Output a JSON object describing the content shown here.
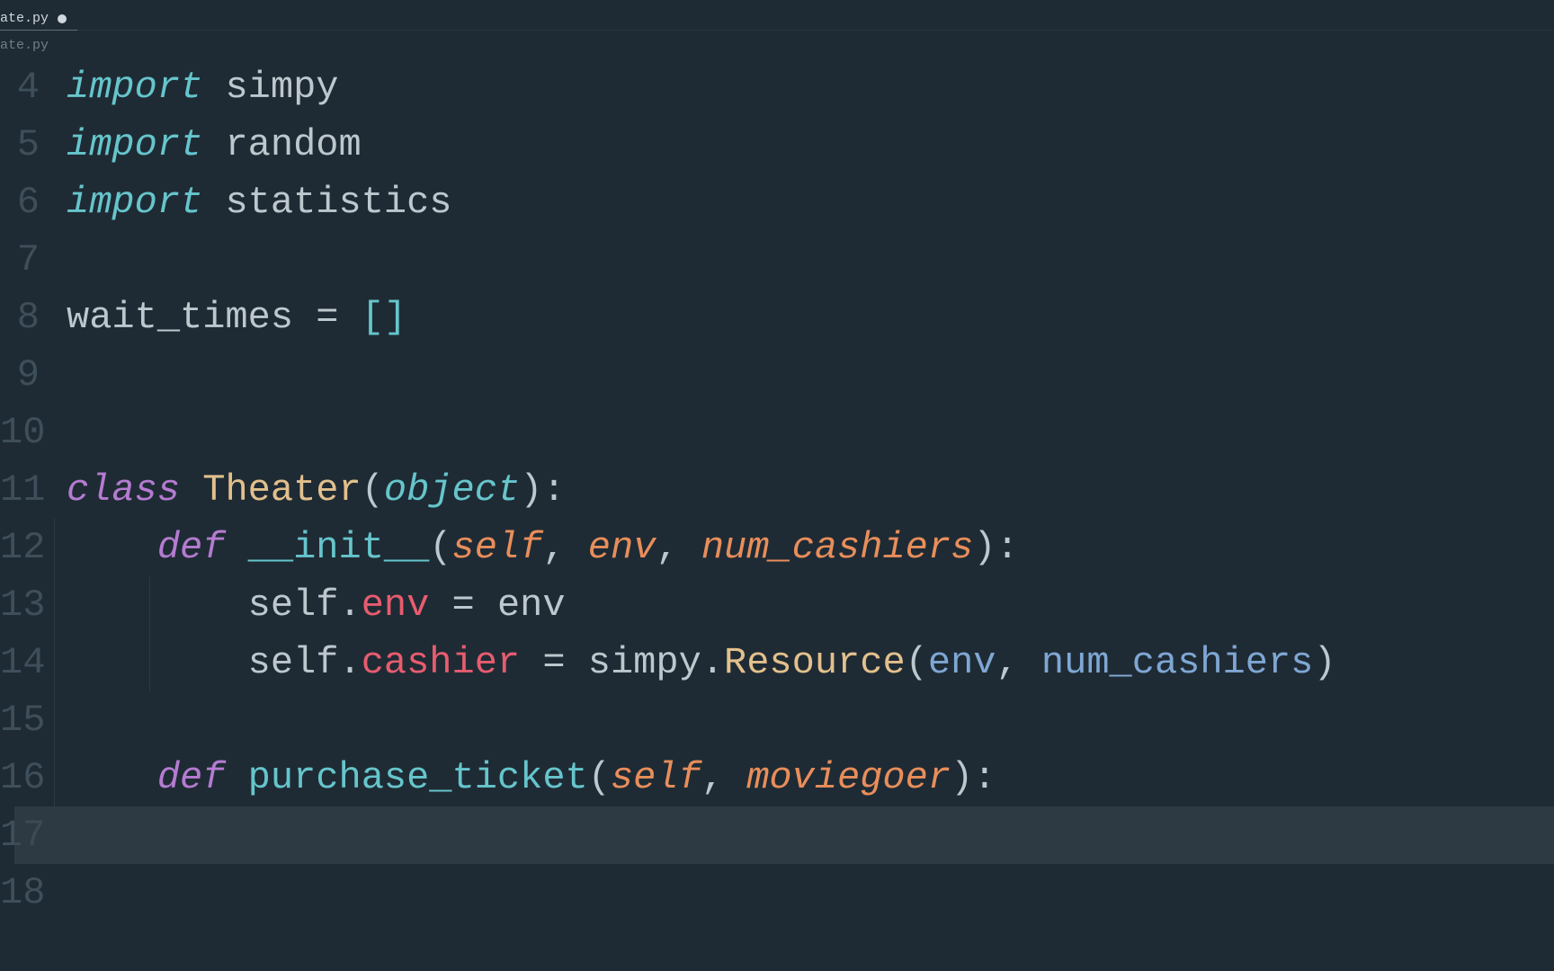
{
  "tab": {
    "filename": "ate.py",
    "modified": true
  },
  "breadcrumb": {
    "filename": "ate.py"
  },
  "code": {
    "first_line_number": 4,
    "lines": [
      {
        "n": 4,
        "tokens": [
          {
            "t": "import",
            "c": "tok-import"
          },
          {
            "t": " ",
            "c": "tok-plain"
          },
          {
            "t": "simpy",
            "c": "tok-plain"
          }
        ]
      },
      {
        "n": 5,
        "tokens": [
          {
            "t": "import",
            "c": "tok-import"
          },
          {
            "t": " ",
            "c": "tok-plain"
          },
          {
            "t": "random",
            "c": "tok-plain"
          }
        ]
      },
      {
        "n": 6,
        "tokens": [
          {
            "t": "import",
            "c": "tok-import"
          },
          {
            "t": " ",
            "c": "tok-plain"
          },
          {
            "t": "statistics",
            "c": "tok-plain"
          }
        ]
      },
      {
        "n": 7,
        "tokens": []
      },
      {
        "n": 8,
        "tokens": [
          {
            "t": "wait_times ",
            "c": "tok-plain"
          },
          {
            "t": "=",
            "c": "tok-op"
          },
          {
            "t": " ",
            "c": "tok-plain"
          },
          {
            "t": "[]",
            "c": "tok-bracket"
          }
        ]
      },
      {
        "n": 9,
        "tokens": []
      },
      {
        "n": 10,
        "tokens": []
      },
      {
        "n": 11,
        "tokens": [
          {
            "t": "class",
            "c": "tok-keyword-class"
          },
          {
            "t": " ",
            "c": "tok-plain"
          },
          {
            "t": "Theater",
            "c": "tok-classname"
          },
          {
            "t": "(",
            "c": "tok-punct"
          },
          {
            "t": "object",
            "c": "tok-builtin"
          },
          {
            "t": ")",
            "c": "tok-punct"
          },
          {
            "t": ":",
            "c": "tok-punct"
          }
        ]
      },
      {
        "n": 12,
        "indent": 1,
        "tokens": [
          {
            "t": "    ",
            "c": "tok-plain"
          },
          {
            "t": "def",
            "c": "tok-keyword-def"
          },
          {
            "t": " ",
            "c": "tok-plain"
          },
          {
            "t": "__init__",
            "c": "tok-magic"
          },
          {
            "t": "(",
            "c": "tok-punct"
          },
          {
            "t": "self",
            "c": "tok-param"
          },
          {
            "t": ", ",
            "c": "tok-punct"
          },
          {
            "t": "env",
            "c": "tok-param"
          },
          {
            "t": ", ",
            "c": "tok-punct"
          },
          {
            "t": "num_cashiers",
            "c": "tok-param"
          },
          {
            "t": ")",
            "c": "tok-punct"
          },
          {
            "t": ":",
            "c": "tok-punct"
          }
        ]
      },
      {
        "n": 13,
        "indent": 2,
        "tokens": [
          {
            "t": "        ",
            "c": "tok-plain"
          },
          {
            "t": "self",
            "c": "tok-self"
          },
          {
            "t": ".",
            "c": "tok-punct"
          },
          {
            "t": "env",
            "c": "tok-attr"
          },
          {
            "t": " ",
            "c": "tok-plain"
          },
          {
            "t": "=",
            "c": "tok-op"
          },
          {
            "t": " env",
            "c": "tok-plain"
          }
        ]
      },
      {
        "n": 14,
        "indent": 2,
        "tokens": [
          {
            "t": "        ",
            "c": "tok-plain"
          },
          {
            "t": "self",
            "c": "tok-self"
          },
          {
            "t": ".",
            "c": "tok-punct"
          },
          {
            "t": "cashier",
            "c": "tok-attr"
          },
          {
            "t": " ",
            "c": "tok-plain"
          },
          {
            "t": "=",
            "c": "tok-op"
          },
          {
            "t": " simpy",
            "c": "tok-module"
          },
          {
            "t": ".",
            "c": "tok-punct"
          },
          {
            "t": "Resource",
            "c": "tok-type"
          },
          {
            "t": "(",
            "c": "tok-punct"
          },
          {
            "t": "env",
            "c": "tok-arg"
          },
          {
            "t": ", ",
            "c": "tok-punct"
          },
          {
            "t": "num_cashiers",
            "c": "tok-arg"
          },
          {
            "t": ")",
            "c": "tok-punct"
          }
        ]
      },
      {
        "n": 15,
        "indent": 1,
        "tokens": []
      },
      {
        "n": 16,
        "indent": 1,
        "tokens": [
          {
            "t": "    ",
            "c": "tok-plain"
          },
          {
            "t": "def",
            "c": "tok-keyword-def"
          },
          {
            "t": " ",
            "c": "tok-plain"
          },
          {
            "t": "purchase_ticket",
            "c": "tok-func"
          },
          {
            "t": "(",
            "c": "tok-punct"
          },
          {
            "t": "self",
            "c": "tok-param"
          },
          {
            "t": ", ",
            "c": "tok-punct"
          },
          {
            "t": "moviegoer",
            "c": "tok-param"
          },
          {
            "t": ")",
            "c": "tok-punct"
          },
          {
            "t": ":",
            "c": "tok-punct"
          }
        ]
      },
      {
        "n": 17,
        "indent": 2,
        "current": true,
        "tokens": []
      },
      {
        "n": 18,
        "tokens": []
      }
    ]
  }
}
